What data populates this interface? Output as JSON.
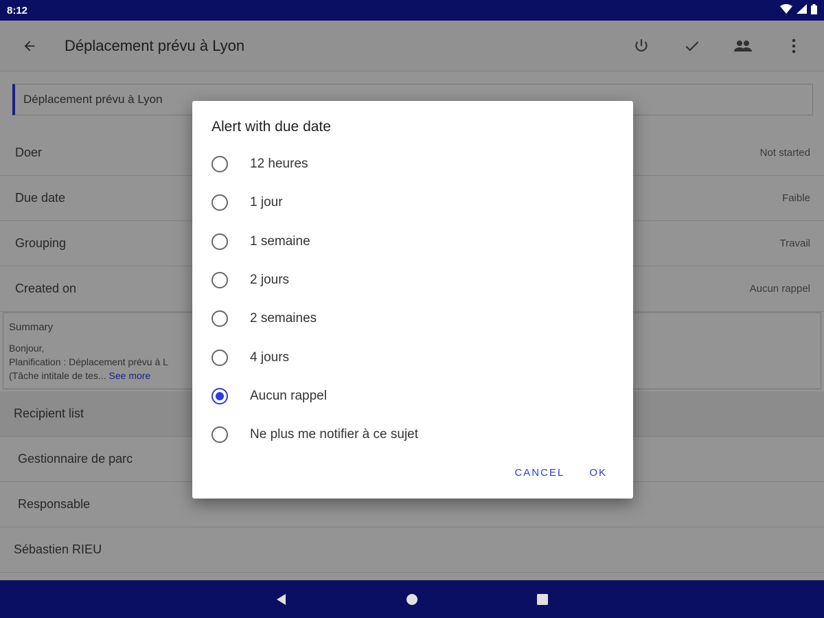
{
  "status_bar": {
    "time": "8:12"
  },
  "appbar": {
    "title": "Déplacement prévu à Lyon"
  },
  "title_field": {
    "value": "Déplacement prévu à Lyon"
  },
  "rows": [
    {
      "label": "Doer",
      "value": "Not started"
    },
    {
      "label": "Due date",
      "value": "Faible"
    },
    {
      "label": "Grouping",
      "value": "Travail"
    },
    {
      "label": "Created on",
      "value": "Aucun rappel"
    }
  ],
  "summary": {
    "label": "Summary",
    "line1": "Bonjour,",
    "line2": "Planification : Déplacement prévu à L",
    "line3": "(Tâche intitale de tes...",
    "see_more": "See more"
  },
  "recipients": {
    "header": "Recipient list",
    "items": [
      "Gestionnaire de parc",
      "Responsable",
      "Sébastien RIEU"
    ]
  },
  "dialog": {
    "title": "Alert with due date",
    "options": [
      "12 heures",
      "1 jour",
      "1 semaine",
      "2 jours",
      "2 semaines",
      "4 jours",
      "Aucun rappel",
      "Ne plus me notifier à ce sujet"
    ],
    "selected": "Aucun rappel",
    "cancel": "CANCEL",
    "ok": "OK"
  },
  "colors": {
    "accent": "#2a3be0",
    "system_bar": "#0a0f63"
  }
}
